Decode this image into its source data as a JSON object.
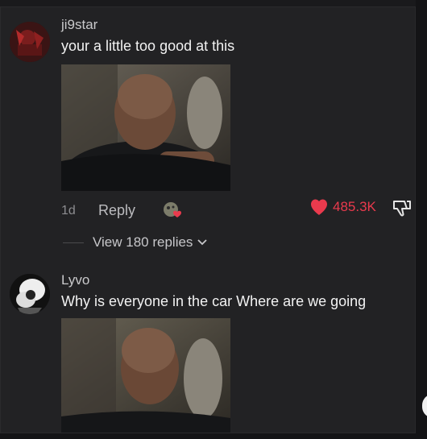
{
  "comments": [
    {
      "username": "ji9star",
      "text": "your a little too good at this",
      "time": "1d",
      "reply_label": "Reply",
      "likes": "485.3K",
      "view_replies": "View 180 replies"
    },
    {
      "username": "Lyvo",
      "text": "Why is everyone in the car Where are we going"
    }
  ],
  "colors": {
    "like": "#ea3a4d",
    "background": "#222224"
  },
  "icons": [
    "heart-icon",
    "thumbs-down-icon",
    "chevron-down-icon",
    "reaction-sticker-icon"
  ]
}
